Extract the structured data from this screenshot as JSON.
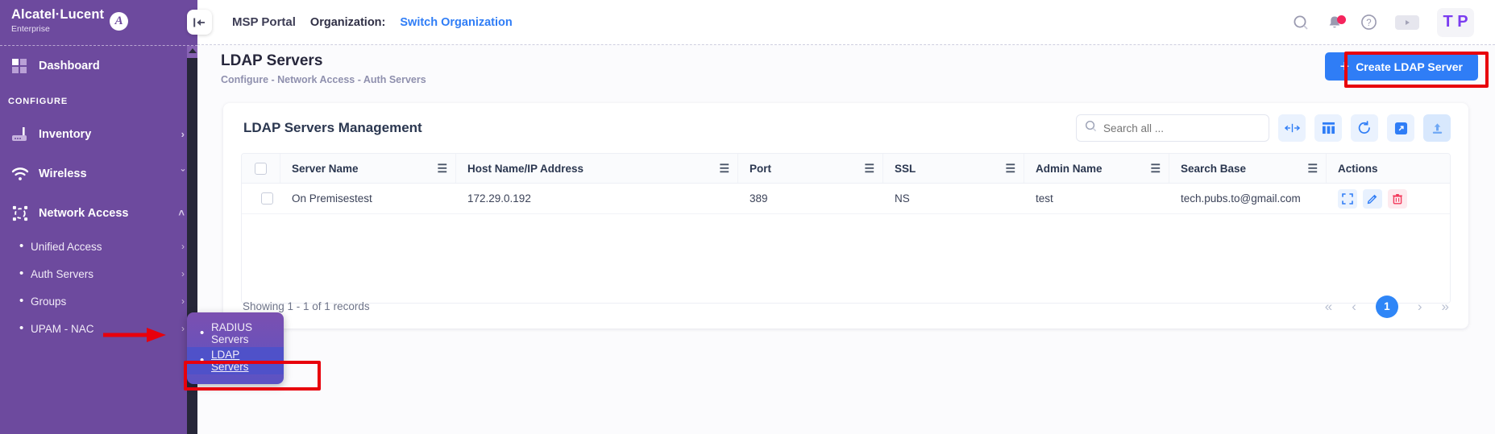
{
  "brand": {
    "name": "Alcatel·Lucent",
    "sub": "Enterprise",
    "logo_glyph": "A"
  },
  "topbar": {
    "collapse_icon": "collapse-left-icon",
    "portal_title": "MSP Portal",
    "org_label": "Organization:",
    "org_link": "Switch Organization",
    "avatar_initials": "T P"
  },
  "page": {
    "title": "LDAP Servers",
    "breadcrumb": "Configure  -  Network Access  -  Auth Servers",
    "create_button": "Create LDAP Server"
  },
  "sidebar": {
    "dashboard": {
      "label": "Dashboard"
    },
    "section_label": "CONFIGURE",
    "items": [
      {
        "label": "Inventory",
        "icon": "router-icon",
        "chevron": "›"
      },
      {
        "label": "Wireless",
        "icon": "wifi-icon",
        "chevron": "ˇ"
      },
      {
        "label": "Network Access",
        "icon": "network-access-icon",
        "chevron": "˄"
      }
    ],
    "sub_items": [
      {
        "label": "Unified Access",
        "chevron": "›"
      },
      {
        "label": "Auth Servers",
        "chevron": "›"
      },
      {
        "label": "Groups",
        "chevron": "›"
      },
      {
        "label": "UPAM - NAC",
        "chevron": "›"
      }
    ],
    "flyout": [
      {
        "label": "RADIUS Servers",
        "active": false
      },
      {
        "label": "LDAP Servers",
        "active": true
      }
    ]
  },
  "card": {
    "title": "LDAP Servers Management",
    "search_placeholder": "Search all ...",
    "search_value": "",
    "tools": [
      {
        "name": "fit-columns-icon"
      },
      {
        "name": "columns-icon"
      },
      {
        "name": "refresh-icon"
      },
      {
        "name": "expand-icon"
      },
      {
        "name": "upload-icon"
      }
    ]
  },
  "table": {
    "columns": [
      "Server Name",
      "Host Name/IP Address",
      "Port",
      "SSL",
      "Admin Name",
      "Search Base",
      "Actions"
    ],
    "rows": [
      {
        "server_name": "On Premisestest",
        "host": "172.29.0.192",
        "port": "389",
        "ssl": "NS",
        "admin_name": "test",
        "search_base": "tech.pubs.to@gmail.com"
      }
    ]
  },
  "footer": {
    "records_text": "Showing 1 - 1 of 1 records",
    "first": "«",
    "prev": "‹",
    "current_page": "1",
    "next": "›",
    "last": "»"
  },
  "colors": {
    "sidebar": "#6d4a9e",
    "accent_blue": "#2f7df6",
    "annotation_red": "#e8000c",
    "danger": "#f2395b"
  }
}
